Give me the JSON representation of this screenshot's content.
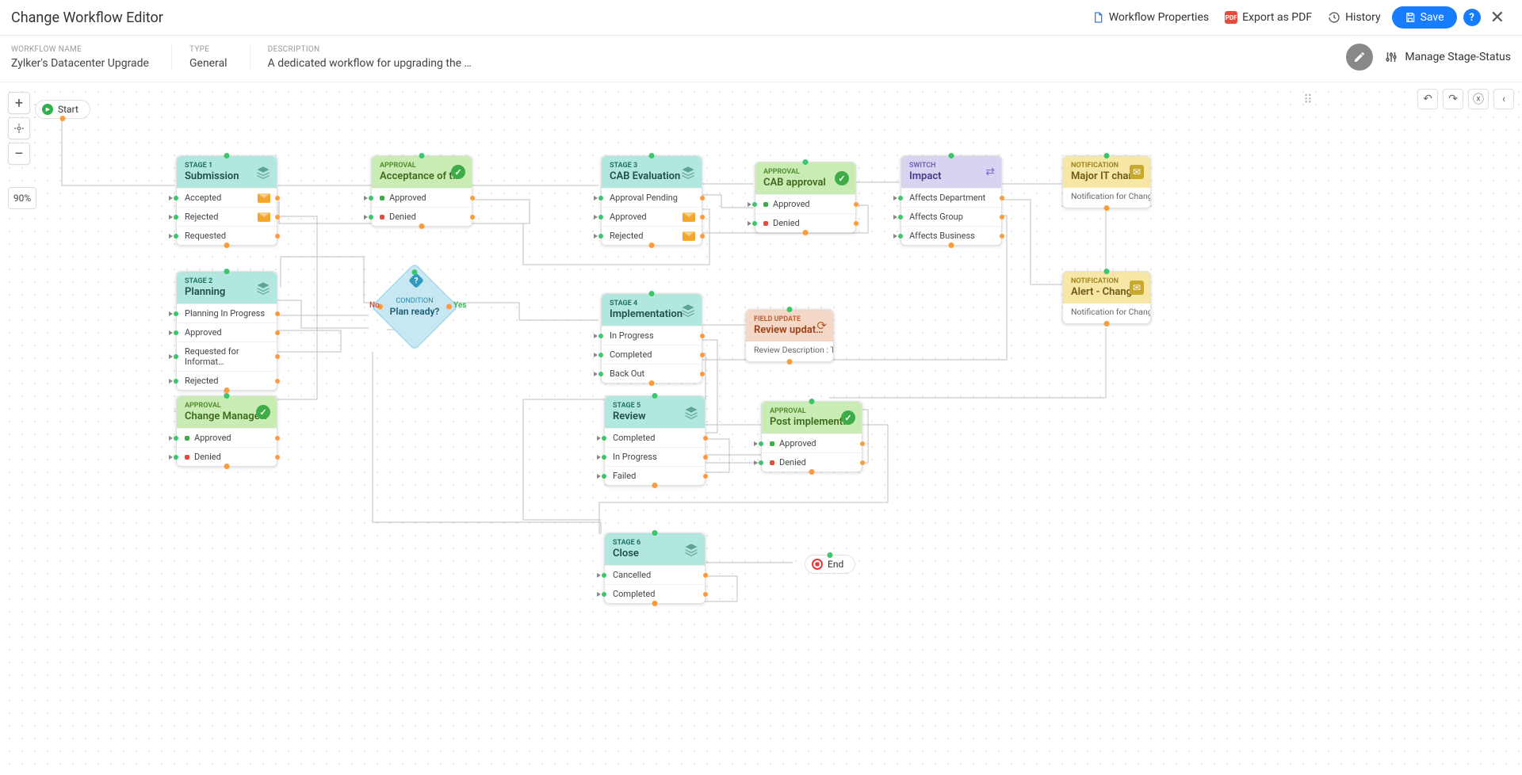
{
  "header": {
    "title": "Change Workflow Editor",
    "workflow_props": "Workflow Properties",
    "export_pdf": "Export as PDF",
    "history": "History",
    "save": "Save"
  },
  "meta": {
    "name_label": "WORKFLOW NAME",
    "name": "Zylker's Datacenter Upgrade",
    "type_label": "TYPE",
    "type": "General",
    "desc_label": "DESCRIPTION",
    "desc": "A dedicated workflow for upgrading the …",
    "manage": "Manage Stage-Status"
  },
  "canvas": {
    "zoom": "90%",
    "start": "Start",
    "end": "End",
    "condition": {
      "label": "CONDITION",
      "q": "Plan ready?",
      "no": "No",
      "yes": "Yes"
    }
  },
  "nodes": {
    "stage1": {
      "stage": "STAGE 1",
      "title": "Submission",
      "rows": [
        {
          "label": "Accepted",
          "mail": true
        },
        {
          "label": "Rejected",
          "mail": true
        },
        {
          "label": "Requested"
        }
      ]
    },
    "app_accept": {
      "stage": "APPROVAL",
      "title": "Acceptance of the…",
      "rows": [
        {
          "label": "Approved",
          "dot": "g"
        },
        {
          "label": "Denied",
          "dot": "r"
        }
      ]
    },
    "stage2": {
      "stage": "STAGE 2",
      "title": "Planning",
      "rows": [
        {
          "label": "Planning In Progress"
        },
        {
          "label": "Approved"
        },
        {
          "label": "Requested for Informat…"
        },
        {
          "label": "Rejected"
        }
      ]
    },
    "app_cm": {
      "stage": "APPROVAL",
      "title": "Change Manager's…",
      "rows": [
        {
          "label": "Approved",
          "dot": "g"
        },
        {
          "label": "Denied",
          "dot": "r"
        }
      ]
    },
    "stage3": {
      "stage": "STAGE 3",
      "title": "CAB Evaluation",
      "rows": [
        {
          "label": "Approval Pending"
        },
        {
          "label": "Approved",
          "mail": true
        },
        {
          "label": "Rejected",
          "mail": true
        }
      ]
    },
    "app_cab": {
      "stage": "APPROVAL",
      "title": "CAB approval",
      "rows": [
        {
          "label": "Approved",
          "dot": "g"
        },
        {
          "label": "Denied",
          "dot": "r"
        }
      ]
    },
    "switch": {
      "stage": "SWITCH",
      "title": "Impact",
      "rows": [
        {
          "label": "Affects Department"
        },
        {
          "label": "Affects Group"
        },
        {
          "label": "Affects Business"
        }
      ]
    },
    "notif1": {
      "stage": "NOTIFICATION",
      "title": "Major IT change",
      "desc": "Notification for Change ID:${display_id.display_value}"
    },
    "notif2": {
      "stage": "NOTIFICATION",
      "title": "Alert - Change in …",
      "desc": "Notification for Change ID:${display_id.display_value}"
    },
    "stage4": {
      "stage": "STAGE 4",
      "title": "Implementation",
      "rows": [
        {
          "label": "In Progress"
        },
        {
          "label": "Completed"
        },
        {
          "label": "Back Out"
        }
      ]
    },
    "fu": {
      "stage": "FIELD UPDATE",
      "title": "Review updates",
      "desc": "Review Description : The t…"
    },
    "stage5": {
      "stage": "STAGE 5",
      "title": "Review",
      "rows": [
        {
          "label": "Completed"
        },
        {
          "label": "In Progress"
        },
        {
          "label": "Failed"
        }
      ]
    },
    "app_post": {
      "stage": "APPROVAL",
      "title": "Post implementat…",
      "rows": [
        {
          "label": "Approved",
          "dot": "g"
        },
        {
          "label": "Denied",
          "dot": "r"
        }
      ]
    },
    "stage6": {
      "stage": "STAGE 6",
      "title": "Close",
      "rows": [
        {
          "label": "Cancelled"
        },
        {
          "label": "Completed"
        }
      ]
    }
  }
}
